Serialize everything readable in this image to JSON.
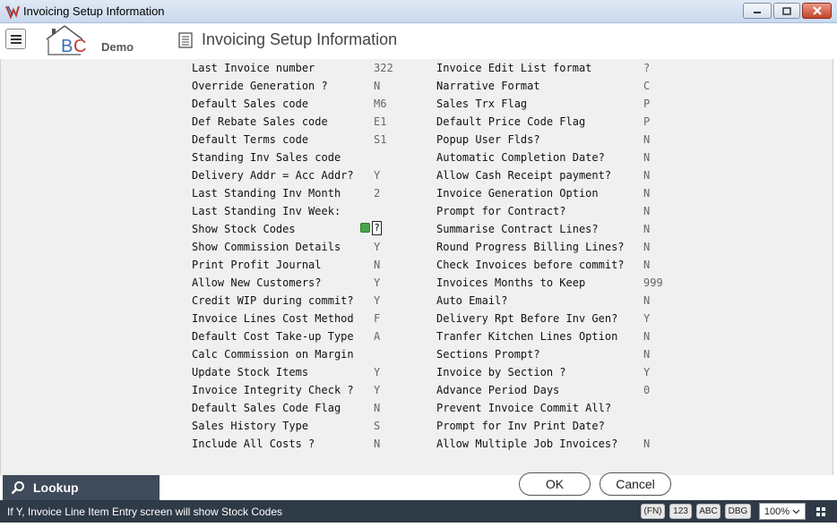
{
  "window": {
    "title": "Invoicing Setup Information"
  },
  "header": {
    "demo_label": "Demo",
    "page_title": "Invoicing Setup Information"
  },
  "left_fields": [
    {
      "label": "Last Invoice number",
      "value": "322"
    },
    {
      "label": "Override Generation ?",
      "value": "N"
    },
    {
      "label": "Default Sales code",
      "value": "M6"
    },
    {
      "label": "Def Rebate Sales code",
      "value": "E1"
    },
    {
      "label": "Default Terms code",
      "value": "S1"
    },
    {
      "label": "Standing Inv Sales code",
      "value": ""
    },
    {
      "label": "Delivery Addr = Acc Addr?",
      "value": "Y"
    },
    {
      "label": "Last Standing Inv Month",
      "value": "2"
    },
    {
      "label": "Last Standing Inv Week:",
      "value": ""
    },
    {
      "label": "Show Stock Codes",
      "value": "?"
    },
    {
      "label": "Show Commission Details",
      "value": "Y"
    },
    {
      "label": "Print Profit Journal",
      "value": "N"
    },
    {
      "label": "Allow New Customers?",
      "value": "Y"
    },
    {
      "label": "Credit WIP during commit?",
      "value": "Y"
    },
    {
      "label": "Invoice Lines Cost Method",
      "value": "F"
    },
    {
      "label": "Default Cost Take-up Type",
      "value": "A"
    },
    {
      "label": "Calc Commission on Margin",
      "value": ""
    },
    {
      "label": "Update Stock Items",
      "value": "Y"
    },
    {
      "label": "Invoice Integrity Check ?",
      "value": "Y"
    },
    {
      "label": "Default Sales Code Flag",
      "value": "N"
    },
    {
      "label": "Sales History Type",
      "value": "S"
    },
    {
      "label": "Include All Costs ?",
      "value": "N"
    }
  ],
  "right_fields": [
    {
      "label": "Invoice Edit List format",
      "value": "?"
    },
    {
      "label": "Narrative Format",
      "value": "C"
    },
    {
      "label": "Sales Trx Flag",
      "value": "P"
    },
    {
      "label": "Default Price Code Flag",
      "value": "P"
    },
    {
      "label": "Popup User Flds?",
      "value": "N"
    },
    {
      "label": "Automatic Completion Date?",
      "value": "N"
    },
    {
      "label": "Allow Cash Receipt payment?",
      "value": "N"
    },
    {
      "label": "Invoice Generation Option",
      "value": "N"
    },
    {
      "label": "Prompt for Contract?",
      "value": "N"
    },
    {
      "label": "Summarise Contract Lines?",
      "value": "N"
    },
    {
      "label": "Round Progress Billing Lines?",
      "value": "N"
    },
    {
      "label": "Check Invoices before commit?",
      "value": "N"
    },
    {
      "label": "Invoices Months to Keep",
      "value": "999"
    },
    {
      "label": "Auto Email?",
      "value": "N"
    },
    {
      "label": "Delivery Rpt Before Inv Gen?",
      "value": "Y"
    },
    {
      "label": "Tranfer Kitchen Lines Option",
      "value": "N"
    },
    {
      "label": "Sections Prompt?",
      "value": "N"
    },
    {
      "label": "Invoice by Section ?",
      "value": "Y"
    },
    {
      "label": "Advance Period Days",
      "value": "0"
    },
    {
      "label": "Prevent Invoice Commit All?",
      "value": ""
    },
    {
      "label": "Prompt for Inv Print Date?",
      "value": ""
    },
    {
      "label": "Allow Multiple Job Invoices?",
      "value": "N"
    }
  ],
  "lookup": {
    "label": "Lookup"
  },
  "buttons": {
    "ok": "OK",
    "cancel": "Cancel"
  },
  "status": {
    "message": "If Y, Invoice Line Item Entry screen will show Stock Codes",
    "pills": [
      "(FN)",
      "123",
      "ABC",
      "DBG"
    ],
    "zoom": "100%"
  },
  "colors": {
    "status_bg": "#2f3a47",
    "lookup_bg": "#3f4a5a",
    "content_bg": "#f0f0f0"
  }
}
